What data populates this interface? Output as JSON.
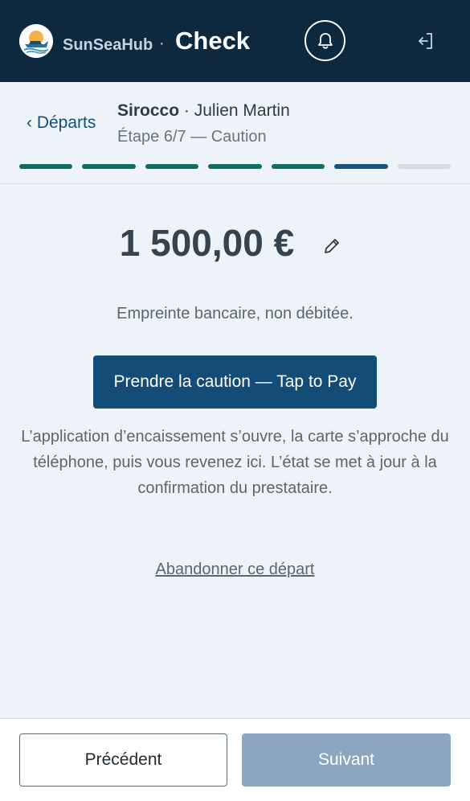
{
  "header": {
    "brand": "SunSeaHub",
    "separator": "·",
    "title": "Check",
    "logo_icon": "boat-logo-icon",
    "notifications_icon": "bell-icon",
    "logout_icon": "logout-icon"
  },
  "subheader": {
    "back_label": "‹ Départs",
    "boat_name": "Sirocco",
    "separator": " · ",
    "client_name": "Julien Martin",
    "step_label": "Étape 6/7 — Caution",
    "progress": {
      "total_steps": 7,
      "current_step": 6,
      "colors": {
        "done": "#0f6d64",
        "current": "#1a5582",
        "todo": "#d3dbe0"
      }
    }
  },
  "deposit": {
    "amount": "1 500,00 €",
    "edit_icon": "pencil-icon",
    "note": "Empreinte bancaire, non débitée.",
    "primary_button": "Prendre la caution — Tap to Pay",
    "help_text": "L’application d’encaissement s’ouvre, la carte s’approche du téléphone, puis vous revenez ici. L’état se met à jour à la confirmation du prestataire.",
    "abandon_link": "Abandonner ce départ"
  },
  "footer": {
    "prev_label": "Précédent",
    "next_label": "Suivant",
    "next_disabled": true
  },
  "colors": {
    "header_bg": "#0d2940",
    "page_bg": "#eef3f8",
    "accent": "#124c77",
    "disabled_button": "#8aa7bf"
  }
}
